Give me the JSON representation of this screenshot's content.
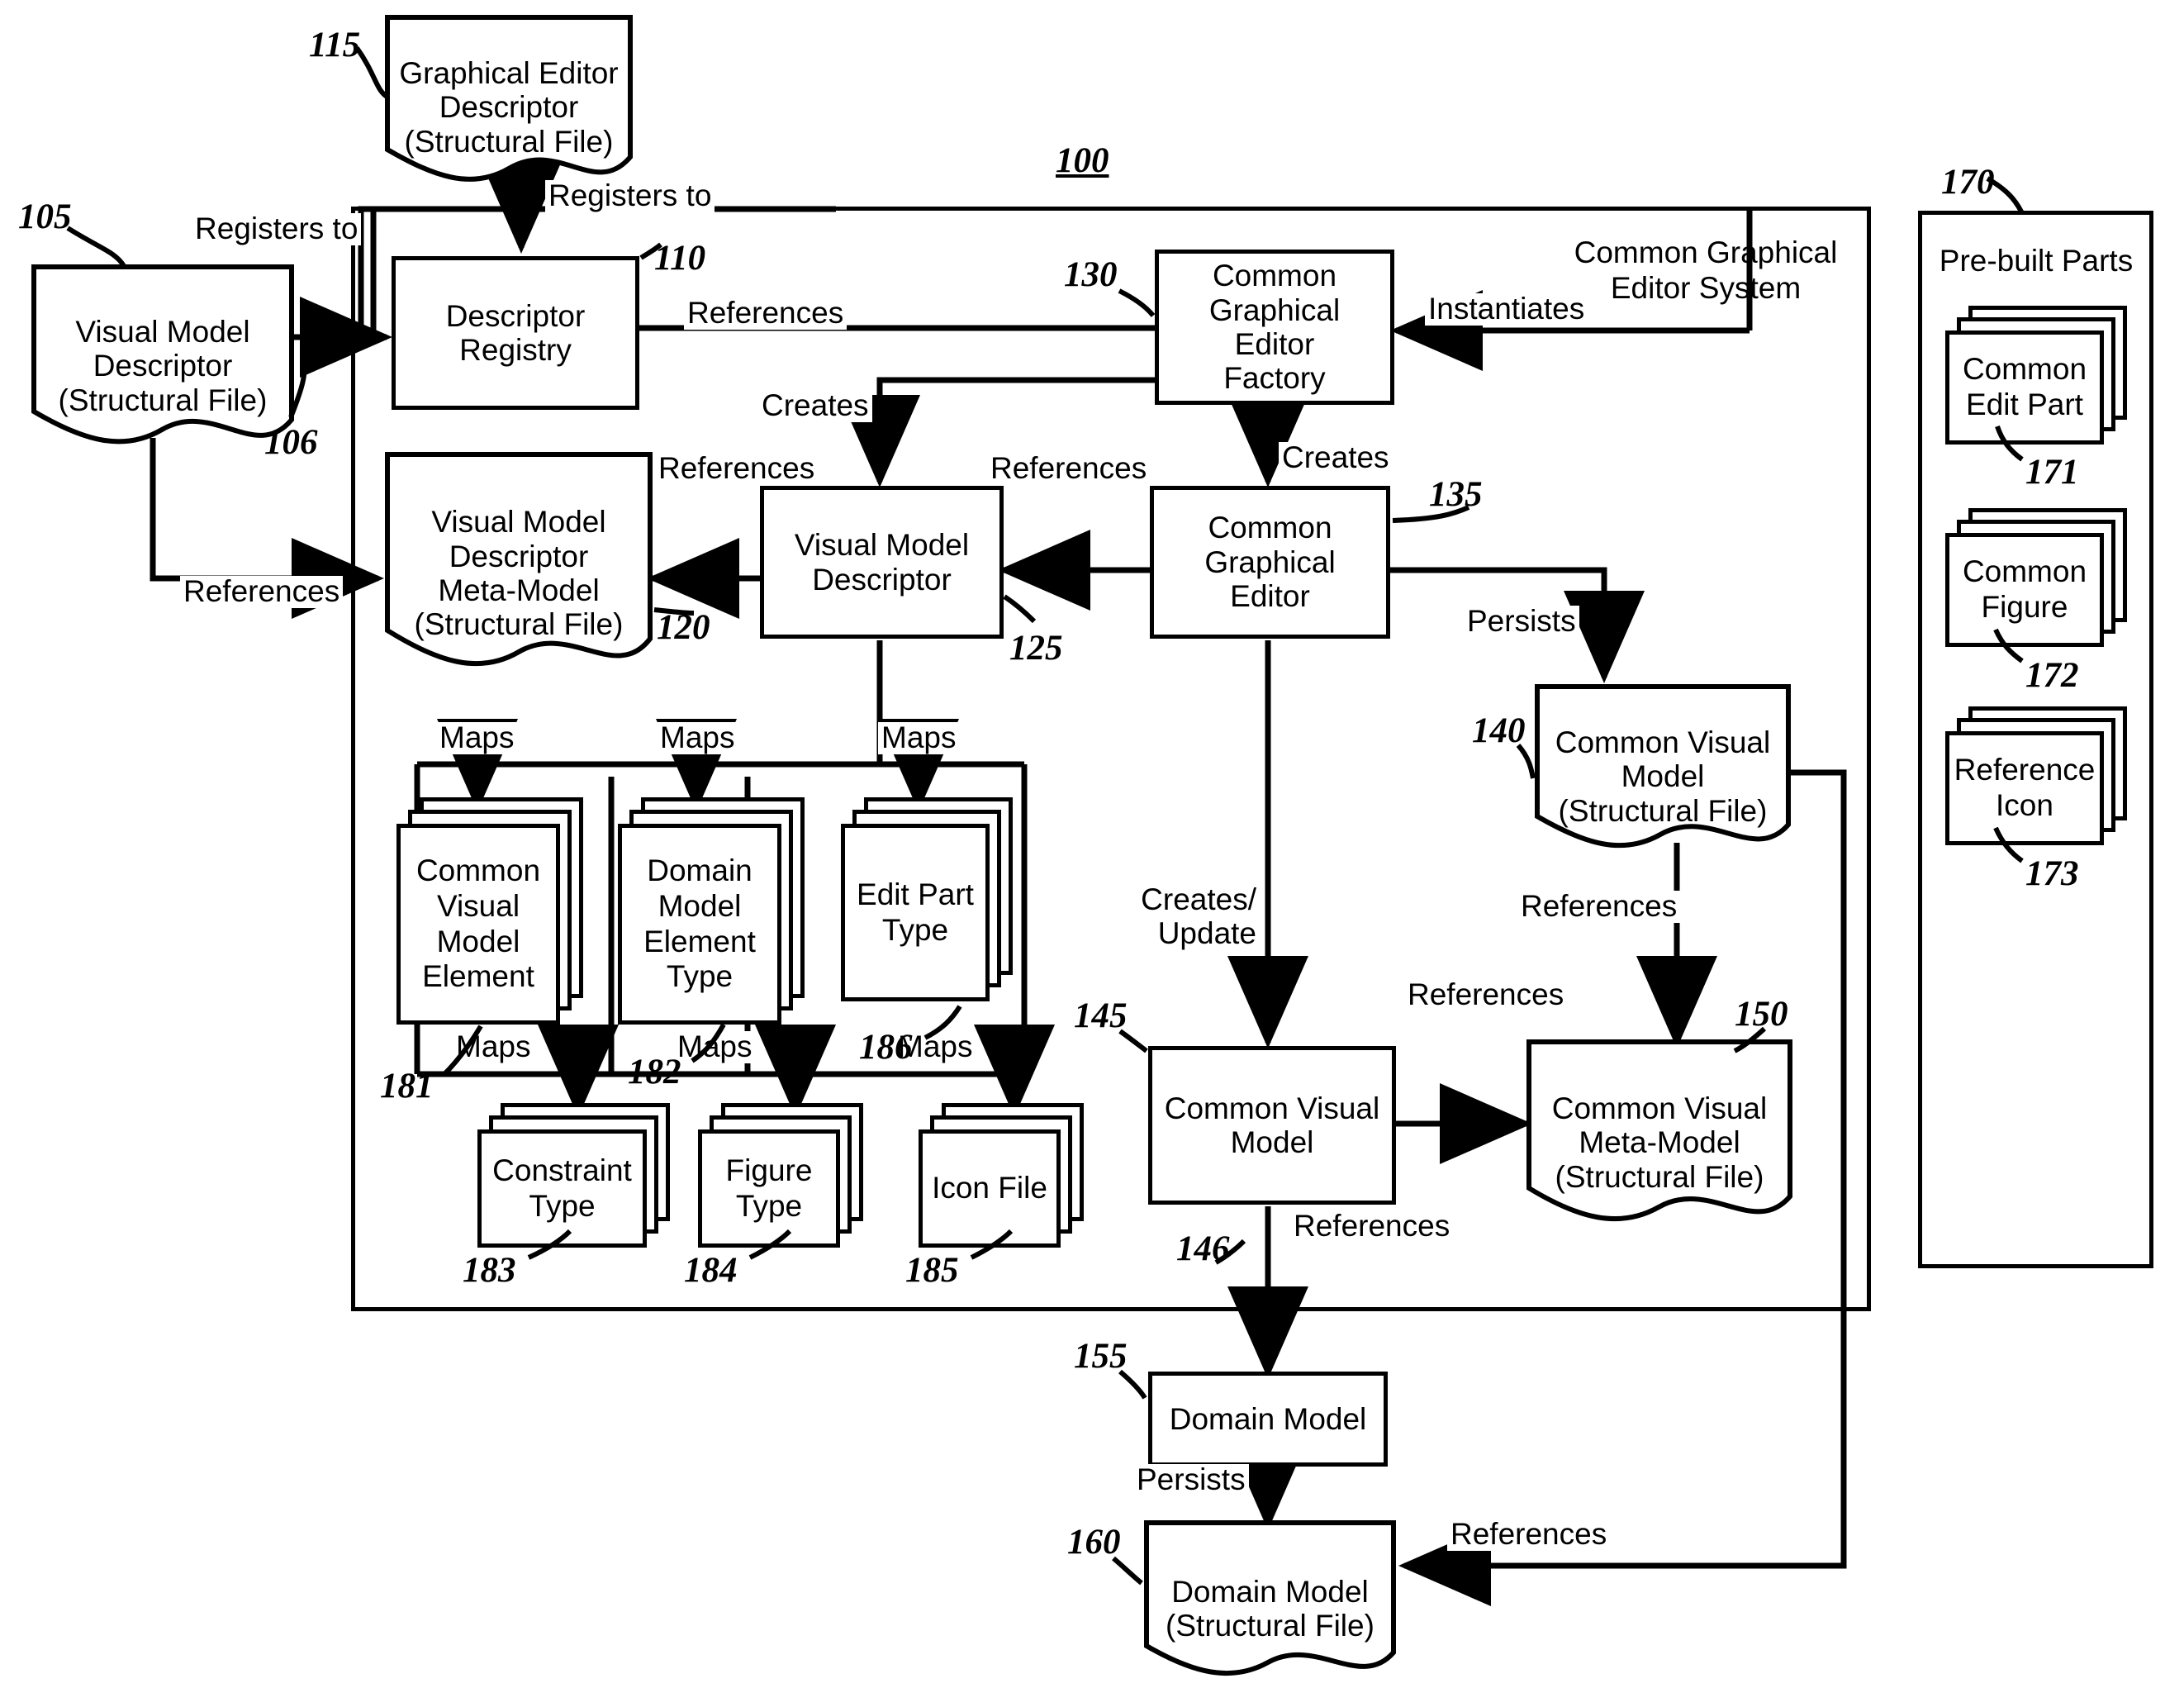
{
  "figure": {
    "system_ref": "100",
    "system_frame_title": "Common Graphical Editor System",
    "prebuilt_frame_title": "Pre-built Parts",
    "prebuilt_ref": "170"
  },
  "nodes": {
    "graphical_editor_descriptor": {
      "ref": "115",
      "line1": "Graphical Editor",
      "line2": "Descriptor",
      "line3": "(Structural File)"
    },
    "visual_model_descriptor_file": {
      "ref": "105",
      "line1": "Visual Model",
      "line2": "Descriptor",
      "line3": "(Structural File)"
    },
    "descriptor_registry": {
      "ref": "110",
      "line1": "Descriptor",
      "line2": "Registry"
    },
    "vmd_meta_model": {
      "ref": "120",
      "line1": "Visual Model",
      "line2": "Descriptor",
      "line3": "Meta-Model",
      "line4": "(Structural File)"
    },
    "visual_model_descriptor": {
      "ref": "125",
      "line1": "Visual Model",
      "line2": "Descriptor"
    },
    "common_graphical_editor_factory": {
      "ref": "130",
      "line1": "Common",
      "line2": "Graphical Editor",
      "line3": "Factory"
    },
    "common_graphical_editor": {
      "ref": "135",
      "line1": "Common",
      "line2": "Graphical Editor"
    },
    "common_visual_model_file": {
      "ref": "140",
      "line1": "Common Visual",
      "line2": "Model",
      "line3": "(Structural File)"
    },
    "common_visual_model": {
      "ref": "145",
      "line1": "Common Visual",
      "line2": "Model"
    },
    "common_visual_meta_model": {
      "ref": "150",
      "line1": "Common Visual",
      "line2": "Meta-Model",
      "line3": "(Structural File)"
    },
    "domain_model": {
      "ref": "155",
      "label": "Domain Model"
    },
    "domain_model_file": {
      "ref": "160",
      "line1": "Domain Model",
      "line2": "(Structural File)"
    },
    "common_visual_model_element": {
      "ref": "181",
      "line1": "Common",
      "line2": "Visual",
      "line3": "Model",
      "line4": "Element"
    },
    "domain_model_element_type": {
      "ref": "182",
      "line1": "Domain",
      "line2": "Model",
      "line3": "Element",
      "line4": "Type"
    },
    "edit_part_type": {
      "ref": "186",
      "line1": "Edit",
      "line2": "Part",
      "line3": "Type"
    },
    "constraint_type": {
      "ref": "183",
      "line1": "Constraint",
      "line2": "Type"
    },
    "figure_type": {
      "ref": "184",
      "line1": "Figure",
      "line2": "Type"
    },
    "icon_file": {
      "ref": "185",
      "line1": "Icon",
      "line2": "File"
    },
    "common_edit_part": {
      "ref": "171",
      "line1": "Common",
      "line2": "Edit Part"
    },
    "common_figure": {
      "ref": "172",
      "line1": "Common",
      "line2": "Figure"
    },
    "reference_icon": {
      "ref": "173",
      "line1": "Reference",
      "line2": "Icon"
    },
    "ref_106": {
      "ref": "106"
    },
    "ref_146": {
      "ref": "146"
    }
  },
  "edges": {
    "registers_to_a": "Registers to",
    "registers_to_b": "Registers to",
    "references_factory_to_registry": "References",
    "creates_factory_to_vmd": "Creates",
    "creates_factory_to_editor": "Creates",
    "references_vmd_to_meta": "References",
    "references_editor_to_vmd": "References",
    "references_vmdfile_to_meta": "References",
    "instantiates": "Instantiates",
    "persists_editor_to_cvmfile": "Persists",
    "references_cvmfile_to_metamodel": "References",
    "creates_update": "Creates/\nUpdate",
    "references_cvm_to_meta": "References",
    "references_cvm_down": "References",
    "persists_domain": "Persists",
    "references_domain_file": "References",
    "maps1": "Maps",
    "maps2": "Maps",
    "maps3": "Maps",
    "maps4": "Maps",
    "maps5": "Maps",
    "maps6": "Maps"
  }
}
